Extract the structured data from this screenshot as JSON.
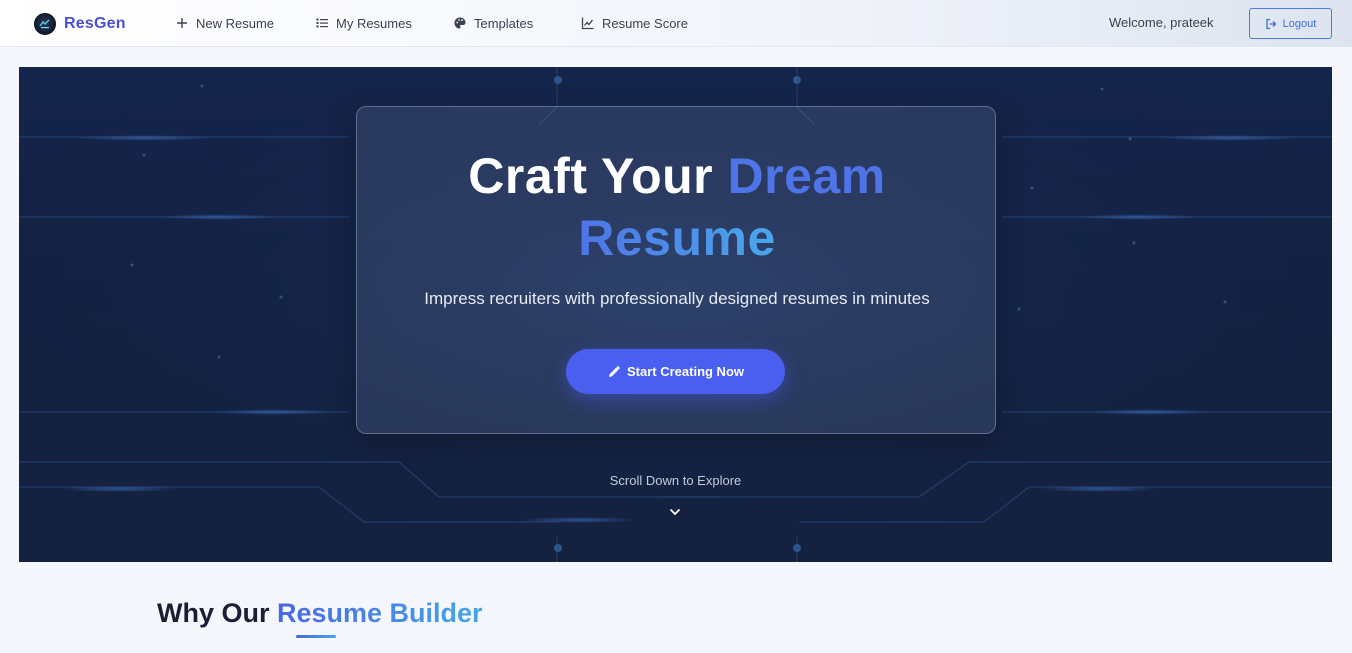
{
  "brand": {
    "name": "ResGen",
    "logo_icon": "resgen-logo-icon"
  },
  "nav": {
    "items": [
      {
        "label": "New Resume",
        "icon": "plus-icon"
      },
      {
        "label": "My Resumes",
        "icon": "list-icon"
      },
      {
        "label": "Templates",
        "icon": "palette-icon"
      },
      {
        "label": "Resume Score",
        "icon": "chart-line-icon"
      }
    ],
    "welcome": "Welcome, prateek",
    "logout_label": "Logout",
    "logout_icon": "logout-icon"
  },
  "hero": {
    "title_part1": "Craft Your ",
    "title_part2": "Dream",
    "title_part3": "Resume",
    "subtitle": "Impress recruiters with professionally designed resumes in minutes",
    "cta_label": "Start Creating Now",
    "cta_icon": "pencil-icon",
    "scroll_text": "Scroll Down to Explore",
    "scroll_icon": "chevron-down-icon"
  },
  "section": {
    "title_part1": "Why Our ",
    "title_part2": "Resume Builder"
  },
  "colors": {
    "brand": "#4a4fd6",
    "hero_bg": "#14213f",
    "accent_blue": "#4f74e8",
    "accent_cyan": "#49a8ea",
    "cta": "#4a5ef0"
  }
}
